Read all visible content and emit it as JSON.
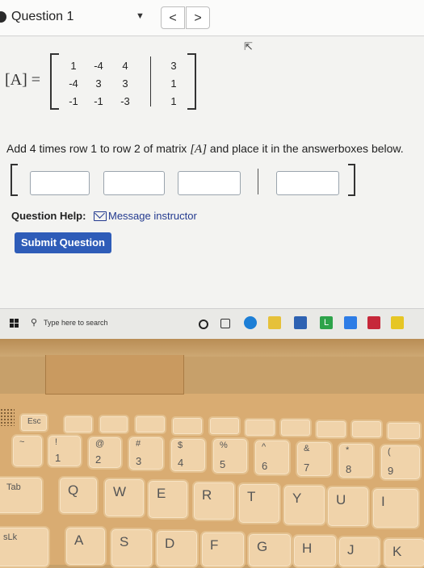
{
  "question": {
    "title": "Question 1",
    "dropdown_icon": "caret-down",
    "prev_label": "<",
    "next_label": ">"
  },
  "matrix": {
    "label": "[A] =",
    "rows": [
      [
        "1",
        "-4",
        "4",
        "3"
      ],
      [
        "-4",
        "3",
        "3",
        "1"
      ],
      [
        "-1",
        "-1",
        "-3",
        "1"
      ]
    ]
  },
  "instruction": {
    "before": "Add 4 times row 1 to row 2 of matrix ",
    "matrix_name": "[A]",
    "after": " and place it in the answerboxes below."
  },
  "answer_boxes": [
    "",
    "",
    "",
    ""
  ],
  "help": {
    "label": "Question Help:",
    "link_text": "Message instructor"
  },
  "submit_label": "Submit Question",
  "taskbar": {
    "search_placeholder": "Type here to search",
    "app_l_label": "L"
  },
  "keyboard": {
    "function_row": [
      "Esc",
      "",
      "",
      "",
      "",
      "",
      "",
      "",
      "",
      "",
      ""
    ],
    "number_row": [
      {
        "top": "~",
        "bot": ""
      },
      {
        "top": "!",
        "bot": "1"
      },
      {
        "top": "@",
        "bot": "2"
      },
      {
        "top": "#",
        "bot": "3"
      },
      {
        "top": "$",
        "bot": "4"
      },
      {
        "top": "%",
        "bot": "5"
      },
      {
        "top": "^",
        "bot": "6"
      },
      {
        "top": "&",
        "bot": "7"
      },
      {
        "top": "*",
        "bot": "8"
      },
      {
        "top": "(",
        "bot": "9"
      }
    ],
    "tab_label": "Tab",
    "qwerty_row": [
      "Q",
      "W",
      "E",
      "R",
      "T",
      "Y",
      "U",
      "I"
    ],
    "capslock_label": "sLk",
    "home_row": [
      "A",
      "S",
      "D",
      "F",
      "G",
      "H",
      "J",
      "K"
    ]
  }
}
